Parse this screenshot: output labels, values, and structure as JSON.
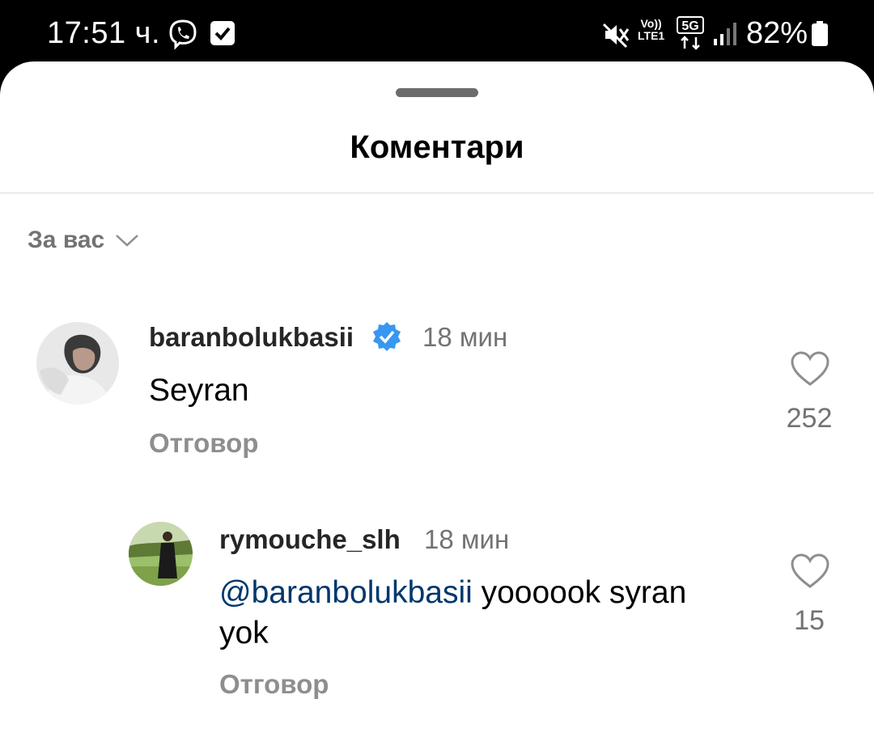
{
  "status_bar": {
    "time": "17:51 ч.",
    "viber_icon": "viber-icon",
    "checkbox_icon": "check-square-icon",
    "mute_icon": "vibrate-mute-icon",
    "volte_top": "Vo))",
    "volte_bottom": "LTE1",
    "network": "5G",
    "battery": "82%"
  },
  "sheet": {
    "title": "Коментари",
    "sort_label": "За вас",
    "sort_icon": "chevron-down-icon"
  },
  "comments": [
    {
      "username": "baranbolukbasii",
      "verified": true,
      "time": "18 мин",
      "text": "Seyran",
      "reply": "Отговор",
      "likes": "252"
    },
    {
      "username": "rymouche_slh",
      "verified": false,
      "time": "18 мин",
      "mention": "@baranbolukbasii",
      "text_line1_rest": " yoooook syran",
      "text_line2": "yok",
      "reply": "Отговор",
      "likes": "15"
    }
  ],
  "colors": {
    "mention": "#00376b",
    "verified": "#3897f0",
    "secondary_text": "#737373"
  }
}
